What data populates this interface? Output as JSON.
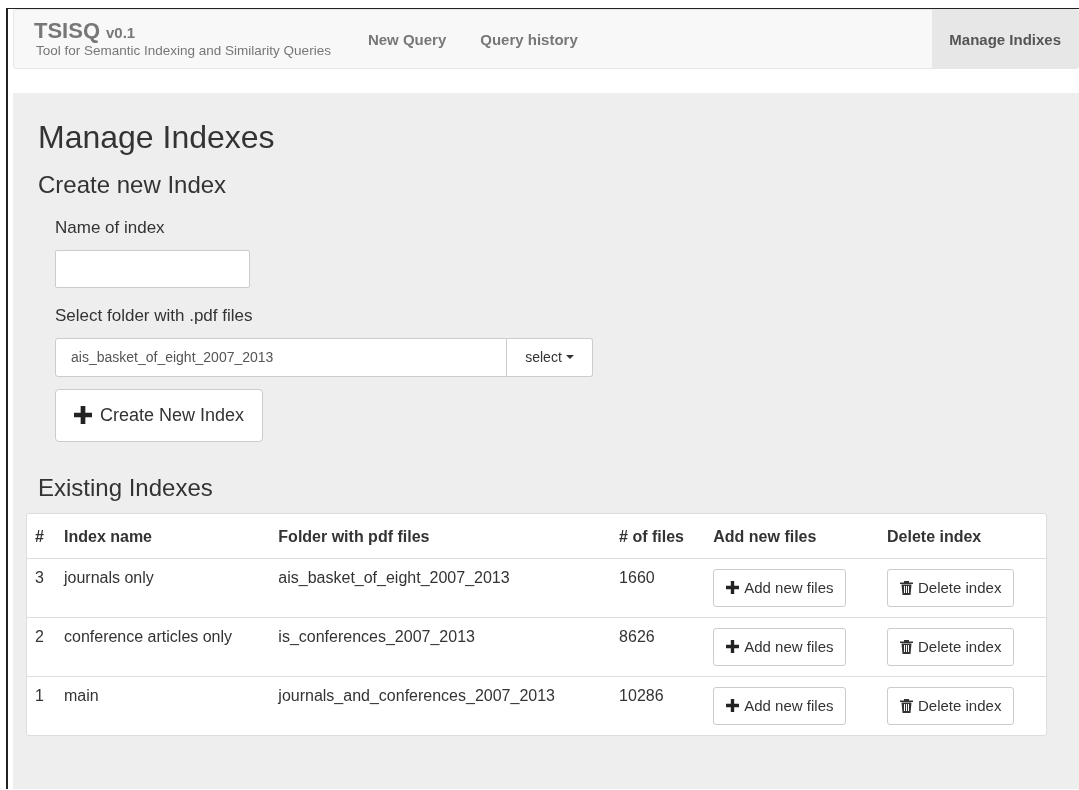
{
  "navbar": {
    "brand": "TSISQ",
    "version": "v0.1",
    "subtitle": "Tool for Semantic Indexing and Similarity Queries",
    "items": [
      {
        "label": "New Query",
        "selected": false
      },
      {
        "label": "Query history",
        "selected": false
      }
    ],
    "right_items": [
      {
        "label": "Manage Indixes",
        "selected": true
      }
    ]
  },
  "page_title": "Manage Indexes",
  "create_section": {
    "heading": "Create new Index",
    "name_label": "Name of index",
    "folder_label": "Select folder with .pdf files",
    "folder_value": "ais_basket_of_eight_2007_2013",
    "select_button": "select",
    "create_button": "Create New Index"
  },
  "existing_section": {
    "heading": "Existing Indexes",
    "columns": [
      "#",
      "Index name",
      "Folder with pdf files",
      "# of files",
      "Add new files",
      "Delete index"
    ],
    "rows": [
      {
        "id": "3",
        "name": "journals only",
        "folder": "ais_basket_of_eight_2007_2013",
        "files": "1660",
        "add_button": "Add new files",
        "delete_button": "Delete index"
      },
      {
        "id": "2",
        "name": "conference articles only",
        "folder": "is_conferences_2007_2013",
        "files": "8626",
        "add_button": "Add new files",
        "delete_button": "Delete index"
      },
      {
        "id": "1",
        "name": "main",
        "folder": "journals_and_conferences_2007_2013",
        "files": "10286",
        "add_button": "Add new files",
        "delete_button": "Delete index"
      }
    ]
  }
}
